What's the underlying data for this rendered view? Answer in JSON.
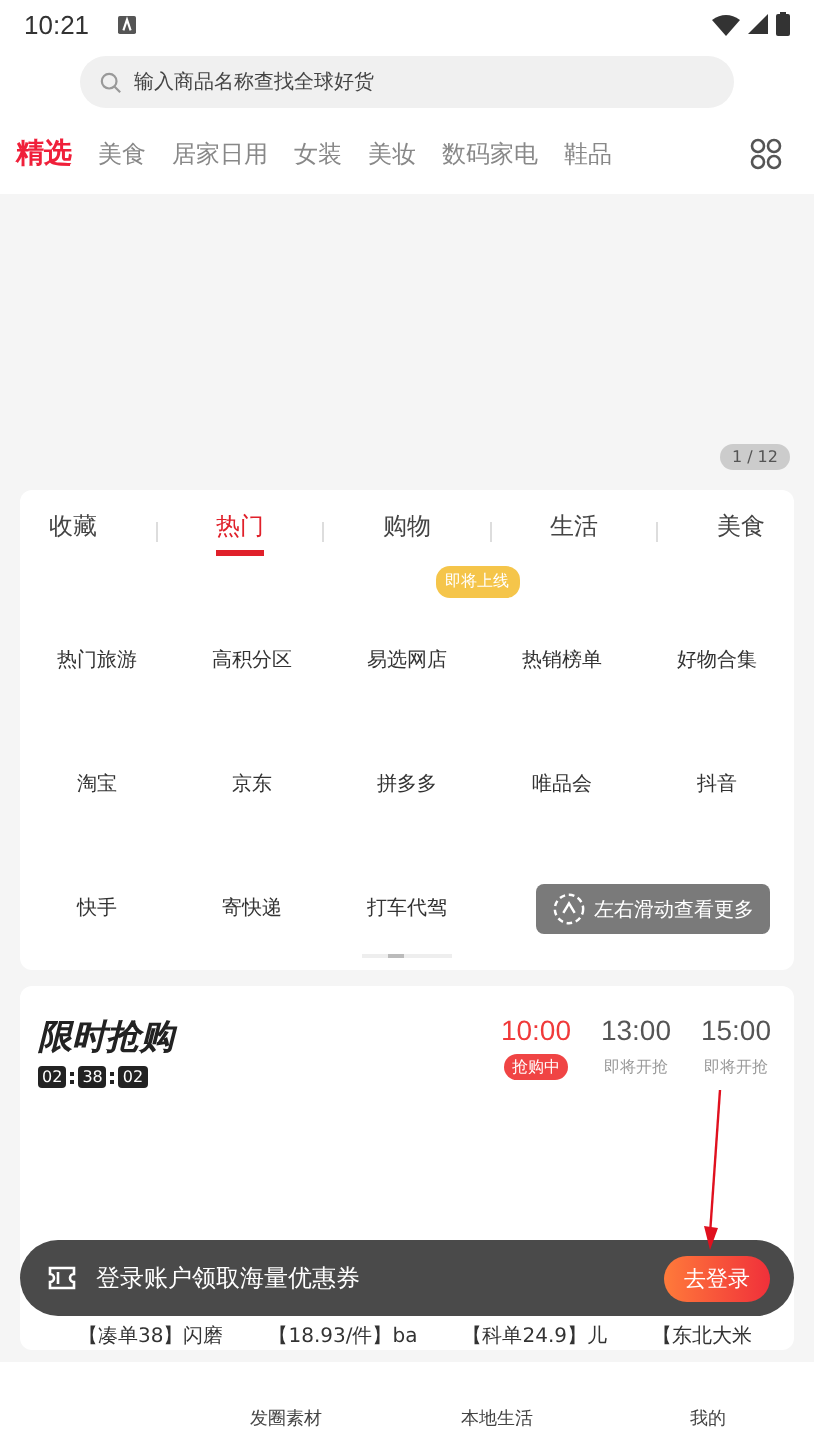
{
  "status_bar": {
    "time": "10:21"
  },
  "search": {
    "placeholder": "输入商品名称查找全球好货"
  },
  "categories": [
    {
      "label": "精选",
      "selected": true
    },
    {
      "label": "美食",
      "selected": false
    },
    {
      "label": "居家日用",
      "selected": false
    },
    {
      "label": "女装",
      "selected": false
    },
    {
      "label": "美妆",
      "selected": false
    },
    {
      "label": "数码家电",
      "selected": false
    },
    {
      "label": "鞋品",
      "selected": false
    }
  ],
  "banner": {
    "counter": "1 / 12"
  },
  "service_tabs": [
    {
      "label": "收藏",
      "selected": false
    },
    {
      "label": "热门",
      "selected": true
    },
    {
      "label": "购物",
      "selected": false
    },
    {
      "label": "生活",
      "selected": false
    },
    {
      "label": "美食",
      "selected": false
    }
  ],
  "coming_soon_badge": "即将上线",
  "services": [
    [
      "热门旅游",
      "高积分区",
      "易选网店",
      "热销榜单",
      "好物合集"
    ],
    [
      "淘宝",
      "京东",
      "拼多多",
      "唯品会",
      "抖音"
    ],
    [
      "快手",
      "寄快递",
      "打车代驾"
    ]
  ],
  "swipe_hint": "左右滑动查看更多",
  "flash_sale": {
    "title": "限时抢购",
    "countdown": [
      "02",
      "38",
      "02"
    ],
    "sessions": [
      {
        "time": "10:00",
        "status": "抢购中",
        "selected": true
      },
      {
        "time": "13:00",
        "status": "即将开抢",
        "selected": false
      },
      {
        "time": "15:00",
        "status": "即将开抢",
        "selected": false
      }
    ],
    "products": [
      "【凑单38】闪磨",
      "【18.93/件】ba",
      "【科单24.9】儿",
      "【东北大米"
    ]
  },
  "login_bar": {
    "text": "登录账户领取海量优惠券",
    "button": "去登录"
  },
  "bottom_nav": [
    "发圈素材",
    "本地生活",
    "我的"
  ]
}
